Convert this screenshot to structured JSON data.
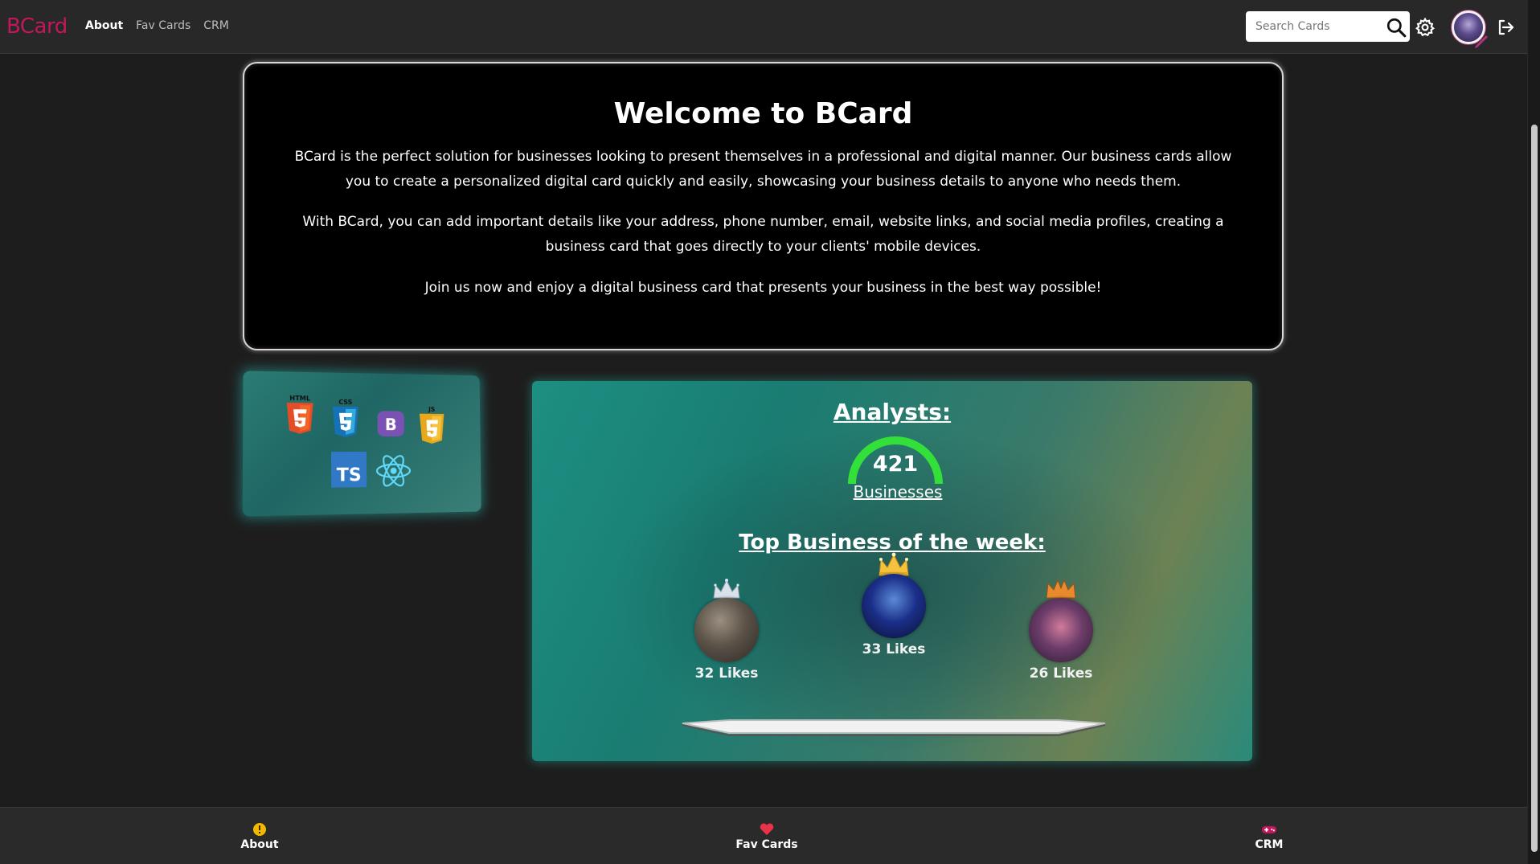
{
  "navbar": {
    "logo": "BCard",
    "links": [
      "About",
      "Fav Cards",
      "CRM"
    ],
    "active_link": "About",
    "search_placeholder": "Search Cards"
  },
  "welcome": {
    "title": "Welcome to BCard",
    "paragraphs": [
      "BCard is the perfect solution for businesses looking to present themselves in a professional and digital manner. Our business cards allow you to create a personalized digital card quickly and easily, showcasing your business details to anyone who needs them.",
      "With BCard, you can add important details like your address, phone number, email, website links, and social media profiles, creating a business card that goes directly to your clients' mobile devices.",
      "Join us now and enjoy a digital business card that presents your business in the best way possible!"
    ]
  },
  "tech_icons": [
    "html5-icon",
    "css3-icon",
    "bootstrap-icon",
    "javascript-icon",
    "typescript-icon",
    "react-icon"
  ],
  "analytics": {
    "title": "Analysts:",
    "business_count": "421",
    "business_label": "Businesses",
    "gauge_color": "#33e03a",
    "top_title": "Top Business of the week:",
    "podium": [
      {
        "place": 2,
        "likes": "32 Likes"
      },
      {
        "place": 1,
        "likes": "33 Likes"
      },
      {
        "place": 3,
        "likes": "26 Likes"
      }
    ]
  },
  "bottom_nav": {
    "items": [
      "About",
      "Fav Cards",
      "CRM"
    ]
  },
  "colors": {
    "brand": "#c2185b",
    "background": "#1d1d1d",
    "teal": "#1d8f82"
  }
}
